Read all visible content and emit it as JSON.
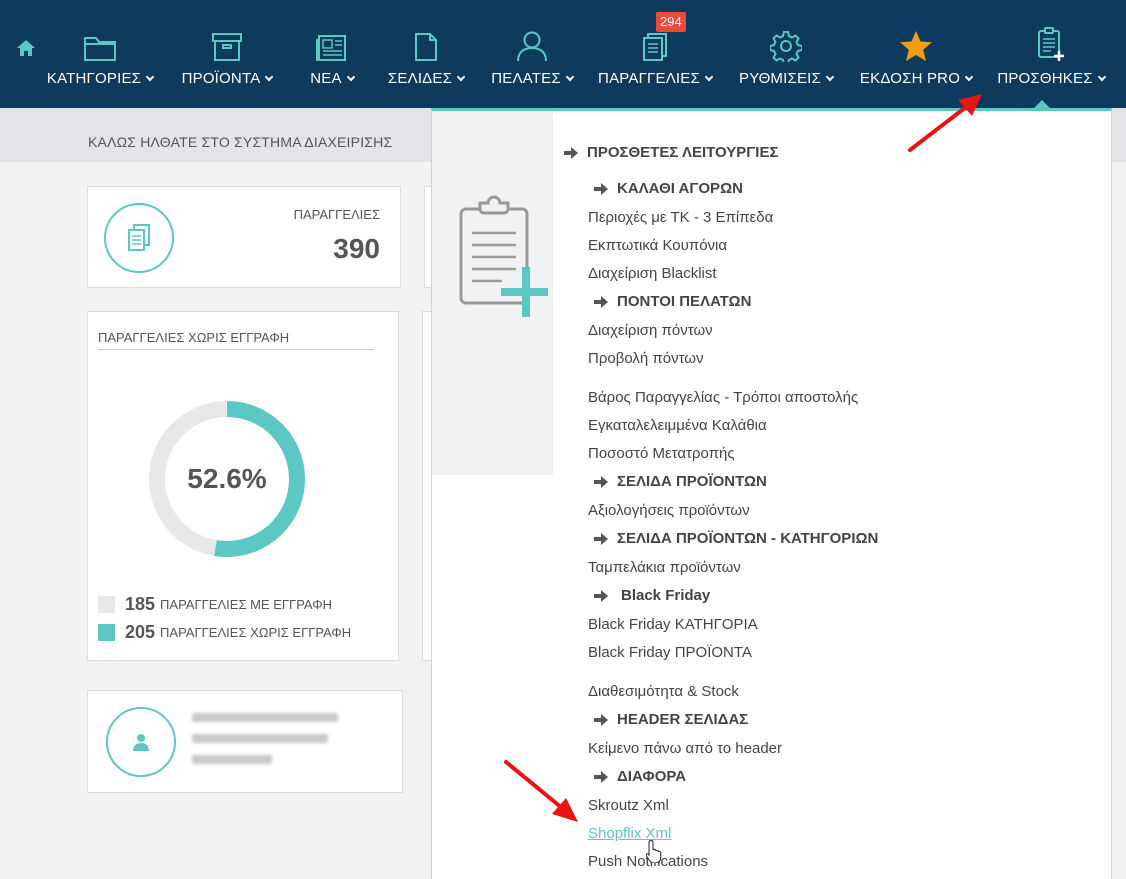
{
  "nav": {
    "home_icon": "home-icon",
    "items": [
      {
        "label": "ΚΑΤΗΓΟΡΙΕΣ",
        "icon": "folder-icon"
      },
      {
        "label": "ΠΡΟΪΟΝΤΑ",
        "icon": "box-icon"
      },
      {
        "label": "ΝΕΑ",
        "icon": "newspaper-icon"
      },
      {
        "label": "ΣΕΛΙΔΕΣ",
        "icon": "page-icon"
      },
      {
        "label": "ΠΕΛΑΤΕΣ",
        "icon": "user-icon"
      },
      {
        "label": "ΠΑΡΑΓΓΕΛΙΕΣ",
        "icon": "orders-icon",
        "badge": "294"
      },
      {
        "label": "ΡΥΘΜΙΣΕΙΣ",
        "icon": "gear-icon"
      },
      {
        "label": "ΕΚΔΟΣΗ PRO",
        "icon": "star-icon"
      },
      {
        "label": "ΠΡΟΣΘΗΚΕΣ",
        "icon": "clipboard-plus-icon"
      }
    ],
    "colors": {
      "bar": "#0e3a5e",
      "accent": "#5bc8c4",
      "badge": "#e74c3c",
      "star": "#f39c12"
    }
  },
  "welcome": "ΚΑΛΩΣ ΗΛΘΑΤΕ ΣΤΟ ΣΥΣΤΗΜΑ ΔΙΑΧΕΙΡΙΣΗΣ",
  "orders_card": {
    "label": "ΠΑΡΑΓΓΕΛΙΕΣ",
    "value": "390"
  },
  "guest_card": {
    "title": "ΠΑΡΑΓΓΕΛΙΕΣ ΧΩΡΙΣ ΕΓΓΡΑΦΗ",
    "percent_label": "52.6%",
    "percent": 52.6,
    "legend": [
      {
        "value": "185",
        "label": "ΠΑΡΑΓΓΕΛΙΕΣ ΜΕ ΕΓΓΡΑΦΗ",
        "color": "#e8e8e8"
      },
      {
        "value": "205",
        "label": "ΠΑΡΑΓΓΕΛΙΕΣ ΧΩΡΙΣ ΕΓΓΡΑΦΗ",
        "color": "#5bc8c4"
      }
    ]
  },
  "dropdown": {
    "main_heading": "ΠΡΟΣΘΕΤΕΣ ΛΕΙΤΟΥΡΓΙΕΣ",
    "sections": {
      "cart": "ΚΑΛΑΘΙ ΑΓΟΡΩΝ",
      "points": "ΠΟΝΤΟΙ ΠΕΛΑΤΩΝ",
      "product_page": "ΣΕΛΙΔΑ ΠΡΟΪΟΝΤΩΝ",
      "product_category_page": "ΣΕΛΙΔΑ ΠΡΟΪΟΝΤΩΝ - ΚΑΤΗΓΟΡΙΩΝ",
      "black_friday": "Black Friday",
      "header": "HEADER ΣΕΛΙΔΑΣ",
      "misc": "ΔΙΑΦΟΡΑ"
    },
    "items": {
      "zip_areas": "Περιοχές με ΤΚ - 3 Επίπεδα",
      "coupons": "Εκπτωτικά Κουπόνια",
      "blacklist": "Διαχείριση Blacklist",
      "points_manage": "Διαχείριση πόντων",
      "points_view": "Προβολή πόντων",
      "weight_shipping": "Βάρος Παραγγελίας - Τρόποι αποστολής",
      "abandoned": "Εγκαταλελειμμένα Καλάθια",
      "conversion": "Ποσοστό Μετατροπής",
      "reviews": "Αξιολογήσεις προϊόντων",
      "tags": "Ταμπελάκια προϊόντων",
      "bf_category": "Black Friday ΚΑΤΗΓΟΡΙΑ",
      "bf_products": "Black Friday ΠΡΟΪΟΝΤΑ",
      "availability": "Διαθεσιμότητα & Stock",
      "header_text": "Κείμενο πάνω από το header",
      "skroutz": "Skroutz Xml",
      "shopflix": "Shopflix Xml",
      "push": "Push Notifications"
    }
  }
}
